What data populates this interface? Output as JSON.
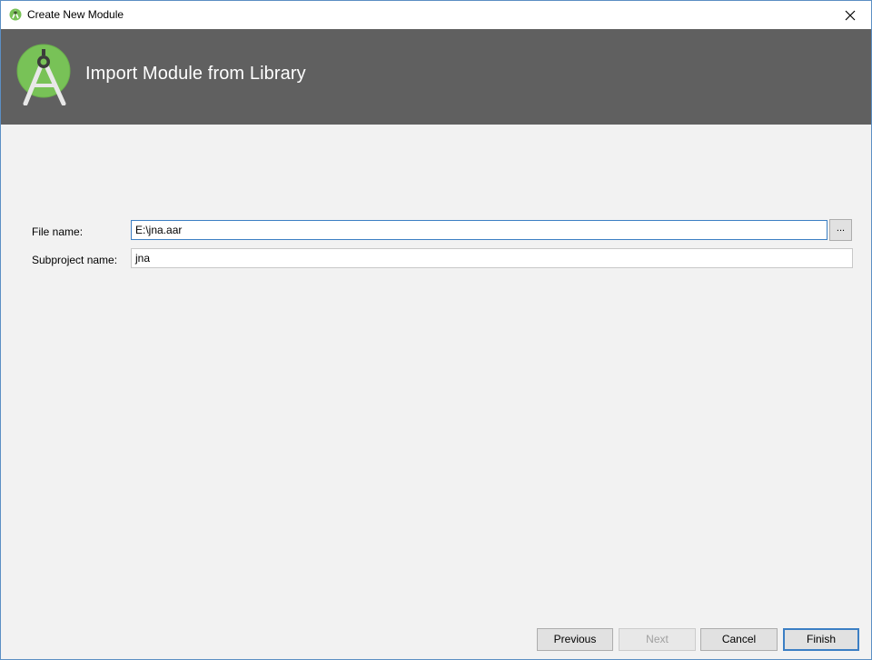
{
  "window": {
    "title": "Create New Module",
    "close_glyph": "✕"
  },
  "banner": {
    "heading": "Import Module from Library",
    "logo_icon": "android-studio-logo-icon",
    "background": "#606060",
    "accent": "#78c257"
  },
  "form": {
    "file_name_label": "File name:",
    "file_name_value": "E:\\jna.aar",
    "browse_label": "...",
    "subproject_label": "Subproject name:",
    "subproject_value": "jna"
  },
  "buttons": {
    "previous": "Previous",
    "next": "Next",
    "cancel": "Cancel",
    "finish": "Finish"
  }
}
